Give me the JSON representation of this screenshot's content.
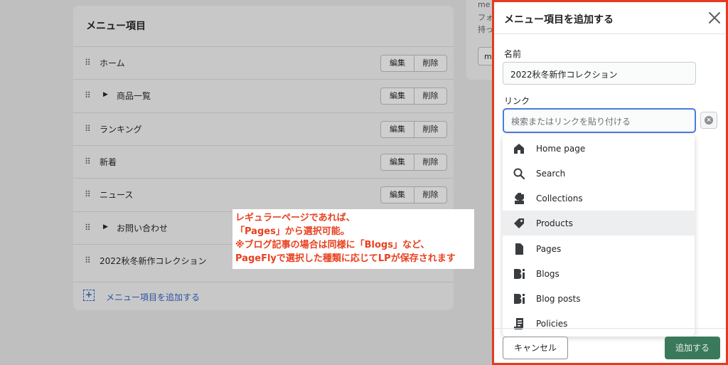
{
  "menu": {
    "title": "メニュー項目",
    "items": [
      {
        "label": "ホーム",
        "expandable": false
      },
      {
        "label": "商品一覧",
        "expandable": true
      },
      {
        "label": "ランキング",
        "expandable": false
      },
      {
        "label": "新着",
        "expandable": false
      },
      {
        "label": "ニュース",
        "expandable": false
      },
      {
        "label": "お問い合わせ",
        "expandable": true
      },
      {
        "label": "2022秋冬新作コレクション",
        "expandable": false
      }
    ],
    "edit_label": "編集",
    "delete_label": "削除",
    "add_label": "メニュー項目を追加する"
  },
  "side_card": {
    "lines": [
      "me",
      "フォ",
      "持っ"
    ],
    "button_label": "m"
  },
  "annotation": {
    "lines": [
      "レギュラーページであれば、",
      "「Pages」から選択可能。",
      "※ブログ記事の場合は同様に「Blogs」など、",
      "PageFlyで選択した種類に応じてLPが保存されます"
    ],
    "color": "#e8401e"
  },
  "modal": {
    "title": "メニュー項目を追加する",
    "name_label": "名前",
    "name_value": "2022秋冬新作コレクション",
    "link_label": "リンク",
    "link_placeholder": "検索またはリンクを貼り付ける",
    "options": [
      {
        "label": "Home page",
        "icon": "home-icon"
      },
      {
        "label": "Search",
        "icon": "search-icon"
      },
      {
        "label": "Collections",
        "icon": "collections-icon"
      },
      {
        "label": "Products",
        "icon": "tag-icon",
        "highlighted": true
      },
      {
        "label": "Pages",
        "icon": "page-icon"
      },
      {
        "label": "Blogs",
        "icon": "blog-icon"
      },
      {
        "label": "Blog posts",
        "icon": "blog-post-icon"
      },
      {
        "label": "Policies",
        "icon": "policy-icon"
      }
    ],
    "cancel_label": "キャンセル",
    "add_label": "追加する",
    "highlight_border": "#e53a1e",
    "primary_color": "#3a7a5a"
  }
}
